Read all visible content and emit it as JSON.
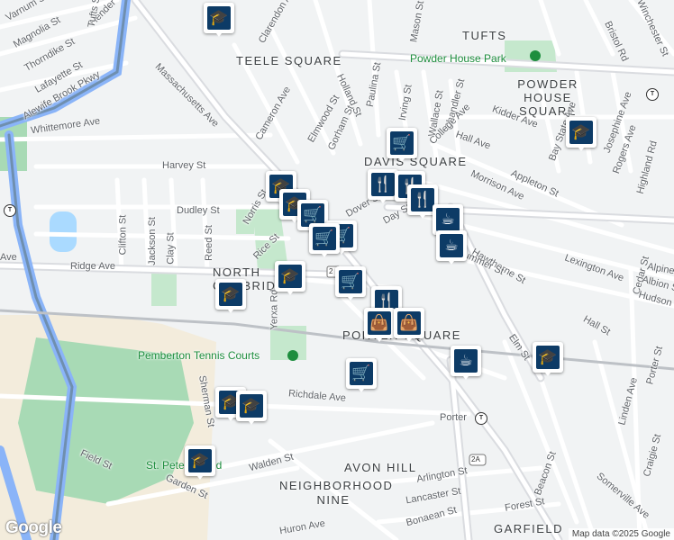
{
  "map": {
    "neighborhoods": [
      {
        "id": "tufts",
        "text": "TUFTS"
      },
      {
        "id": "teele",
        "text": "TEELE SQUARE"
      },
      {
        "id": "powder",
        "text": "POWDER HOUSE SQUARE"
      },
      {
        "id": "davis",
        "text": "DAVIS SQUARE"
      },
      {
        "id": "northcam",
        "text": "NORTH CAMBRIDGE"
      },
      {
        "id": "porter",
        "text": "PORTER SQUARE"
      },
      {
        "id": "avon",
        "text": "AVON HILL"
      },
      {
        "id": "nine",
        "text": "NEIGHBORHOOD NINE"
      },
      {
        "id": "garfield",
        "text": "GARFIELD"
      }
    ],
    "parks": [
      {
        "id": "powderpark",
        "text": "Powder House Park"
      },
      {
        "id": "pemberton",
        "text": "Pemberton Tennis Courts"
      },
      {
        "id": "stpeter",
        "text": "St. Peter's Field"
      }
    ],
    "streets": [
      "Varnum St",
      "Magnolia St",
      "Thorndike St",
      "Lafayette St",
      "Hender",
      "Alewife Brook Pkwy",
      "Massachusetts Ave",
      "Whittemore Ave",
      "Cameron Ave",
      "Clarendon Ave",
      "Elmwood St",
      "Gorham St",
      "Holland St",
      "Paulina St",
      "Mason St",
      "Irving St",
      "Wallace St",
      "Chandler St",
      "College Ave",
      "Kidder Ave",
      "Hall Ave",
      "Morrison Ave",
      "Bay State Ave",
      "Appleton St",
      "Josephine Ave",
      "Rogers Ave",
      "Highland Rd",
      "Winchester St",
      "Bristol Rd",
      "Harvey St",
      "Dudley St",
      "Norris St",
      "Clifton St",
      "Jackson St",
      "Clay St",
      "Reed St",
      "Rice St",
      "Ridge Ave",
      "Yerxa Rd",
      "Dover St",
      "Day St",
      "Hawthorne St",
      "Elm St",
      "Lexington Ave",
      "Cedar St",
      "Albion St",
      "Hudson St",
      "Alpine St",
      "Hall St",
      "Porter St",
      "Linden Ave",
      "Craigie St",
      "Summer St",
      "Richdale Ave",
      "Porter",
      "Sherman St",
      "Walden St",
      "Field St",
      "Garden St",
      "Arlington St",
      "Lancaster St",
      "Forest St",
      "Somerville Ave",
      "Beacon St",
      "Huron Ave",
      "Bonaean St",
      "Tufts St",
      "Ave"
    ],
    "route_badge": "2A",
    "route_badge_2": "2",
    "brand": "Google",
    "attribution": "Map data ©2025 Google",
    "pin_icons": {
      "school": "graduation-cap-icon",
      "grocery": "shopping-cart-icon",
      "restaurant": "fork-knife-icon",
      "cafe": "coffee-cup-icon",
      "shopping": "shopping-bag-icon"
    }
  }
}
